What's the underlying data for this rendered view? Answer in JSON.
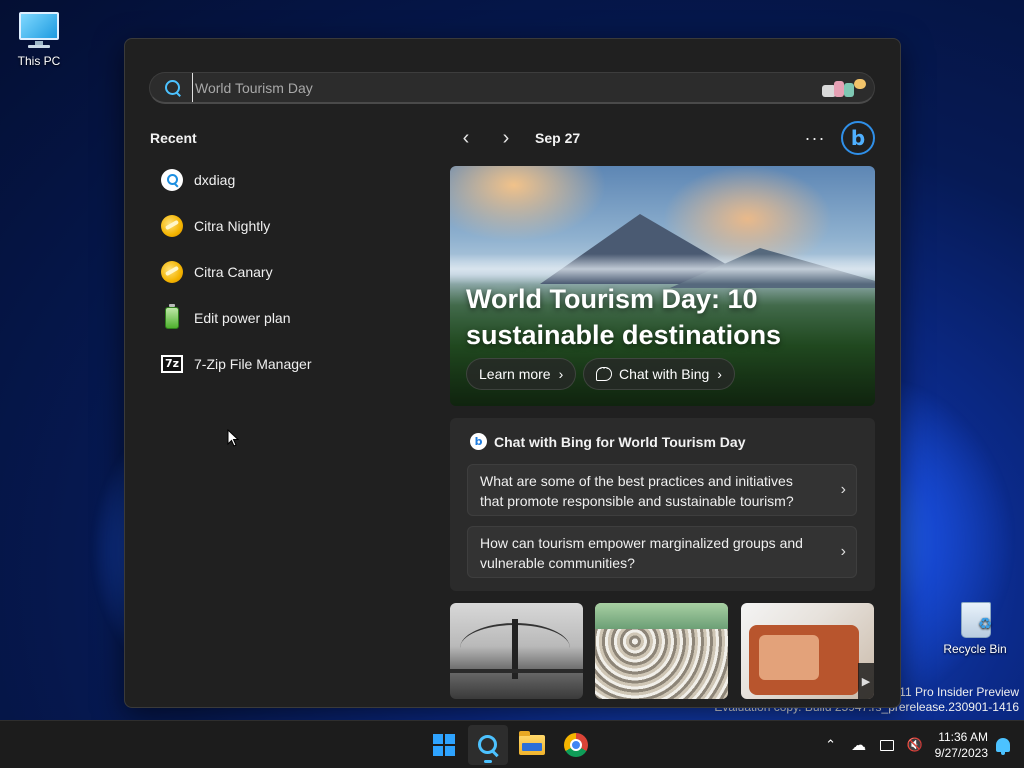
{
  "desktop": {
    "icons": [
      {
        "label": "This PC",
        "icon": "computer-icon"
      },
      {
        "label": "Recycle Bin",
        "icon": "recycle-bin-icon"
      }
    ],
    "watermark": {
      "line1": "s 11 Pro Insider Preview",
      "line2": "Evaluation copy. Build 25947.rs_prerelease.230901-1416"
    }
  },
  "search": {
    "placeholder": "World Tourism Day",
    "value": ""
  },
  "recent": {
    "title": "Recent",
    "items": [
      {
        "label": "dxdiag",
        "icon": "search-result-icon"
      },
      {
        "label": "Citra Nightly",
        "icon": "citra-icon"
      },
      {
        "label": "Citra Canary",
        "icon": "citra-icon"
      },
      {
        "label": "Edit power plan",
        "icon": "battery-icon"
      },
      {
        "label": "7-Zip File Manager",
        "icon": "7zip-icon",
        "icon_text": "7z"
      }
    ]
  },
  "highlights": {
    "date": "Sep 27",
    "more_label": "···",
    "bing_letter": "b",
    "hero": {
      "title": "World Tourism Day: 10 sustainable destinations",
      "learn_more": "Learn more",
      "chat_with_bing": "Chat with Bing"
    },
    "chat_card": {
      "title": "Chat with Bing for World Tourism Day",
      "questions": [
        "What are some of the best practices and initiatives that promote responsible and sustainable tourism?",
        "How can tourism empower marginalized groups and vulnerable communities?"
      ]
    }
  },
  "taskbar": {
    "apps": [
      "start",
      "search",
      "file-explorer",
      "chrome"
    ],
    "clock": {
      "time": "11:36 AM",
      "date": "9/27/2023"
    },
    "colors": {
      "accent": "#4cc2ff",
      "background": "#1c1c1c"
    }
  }
}
